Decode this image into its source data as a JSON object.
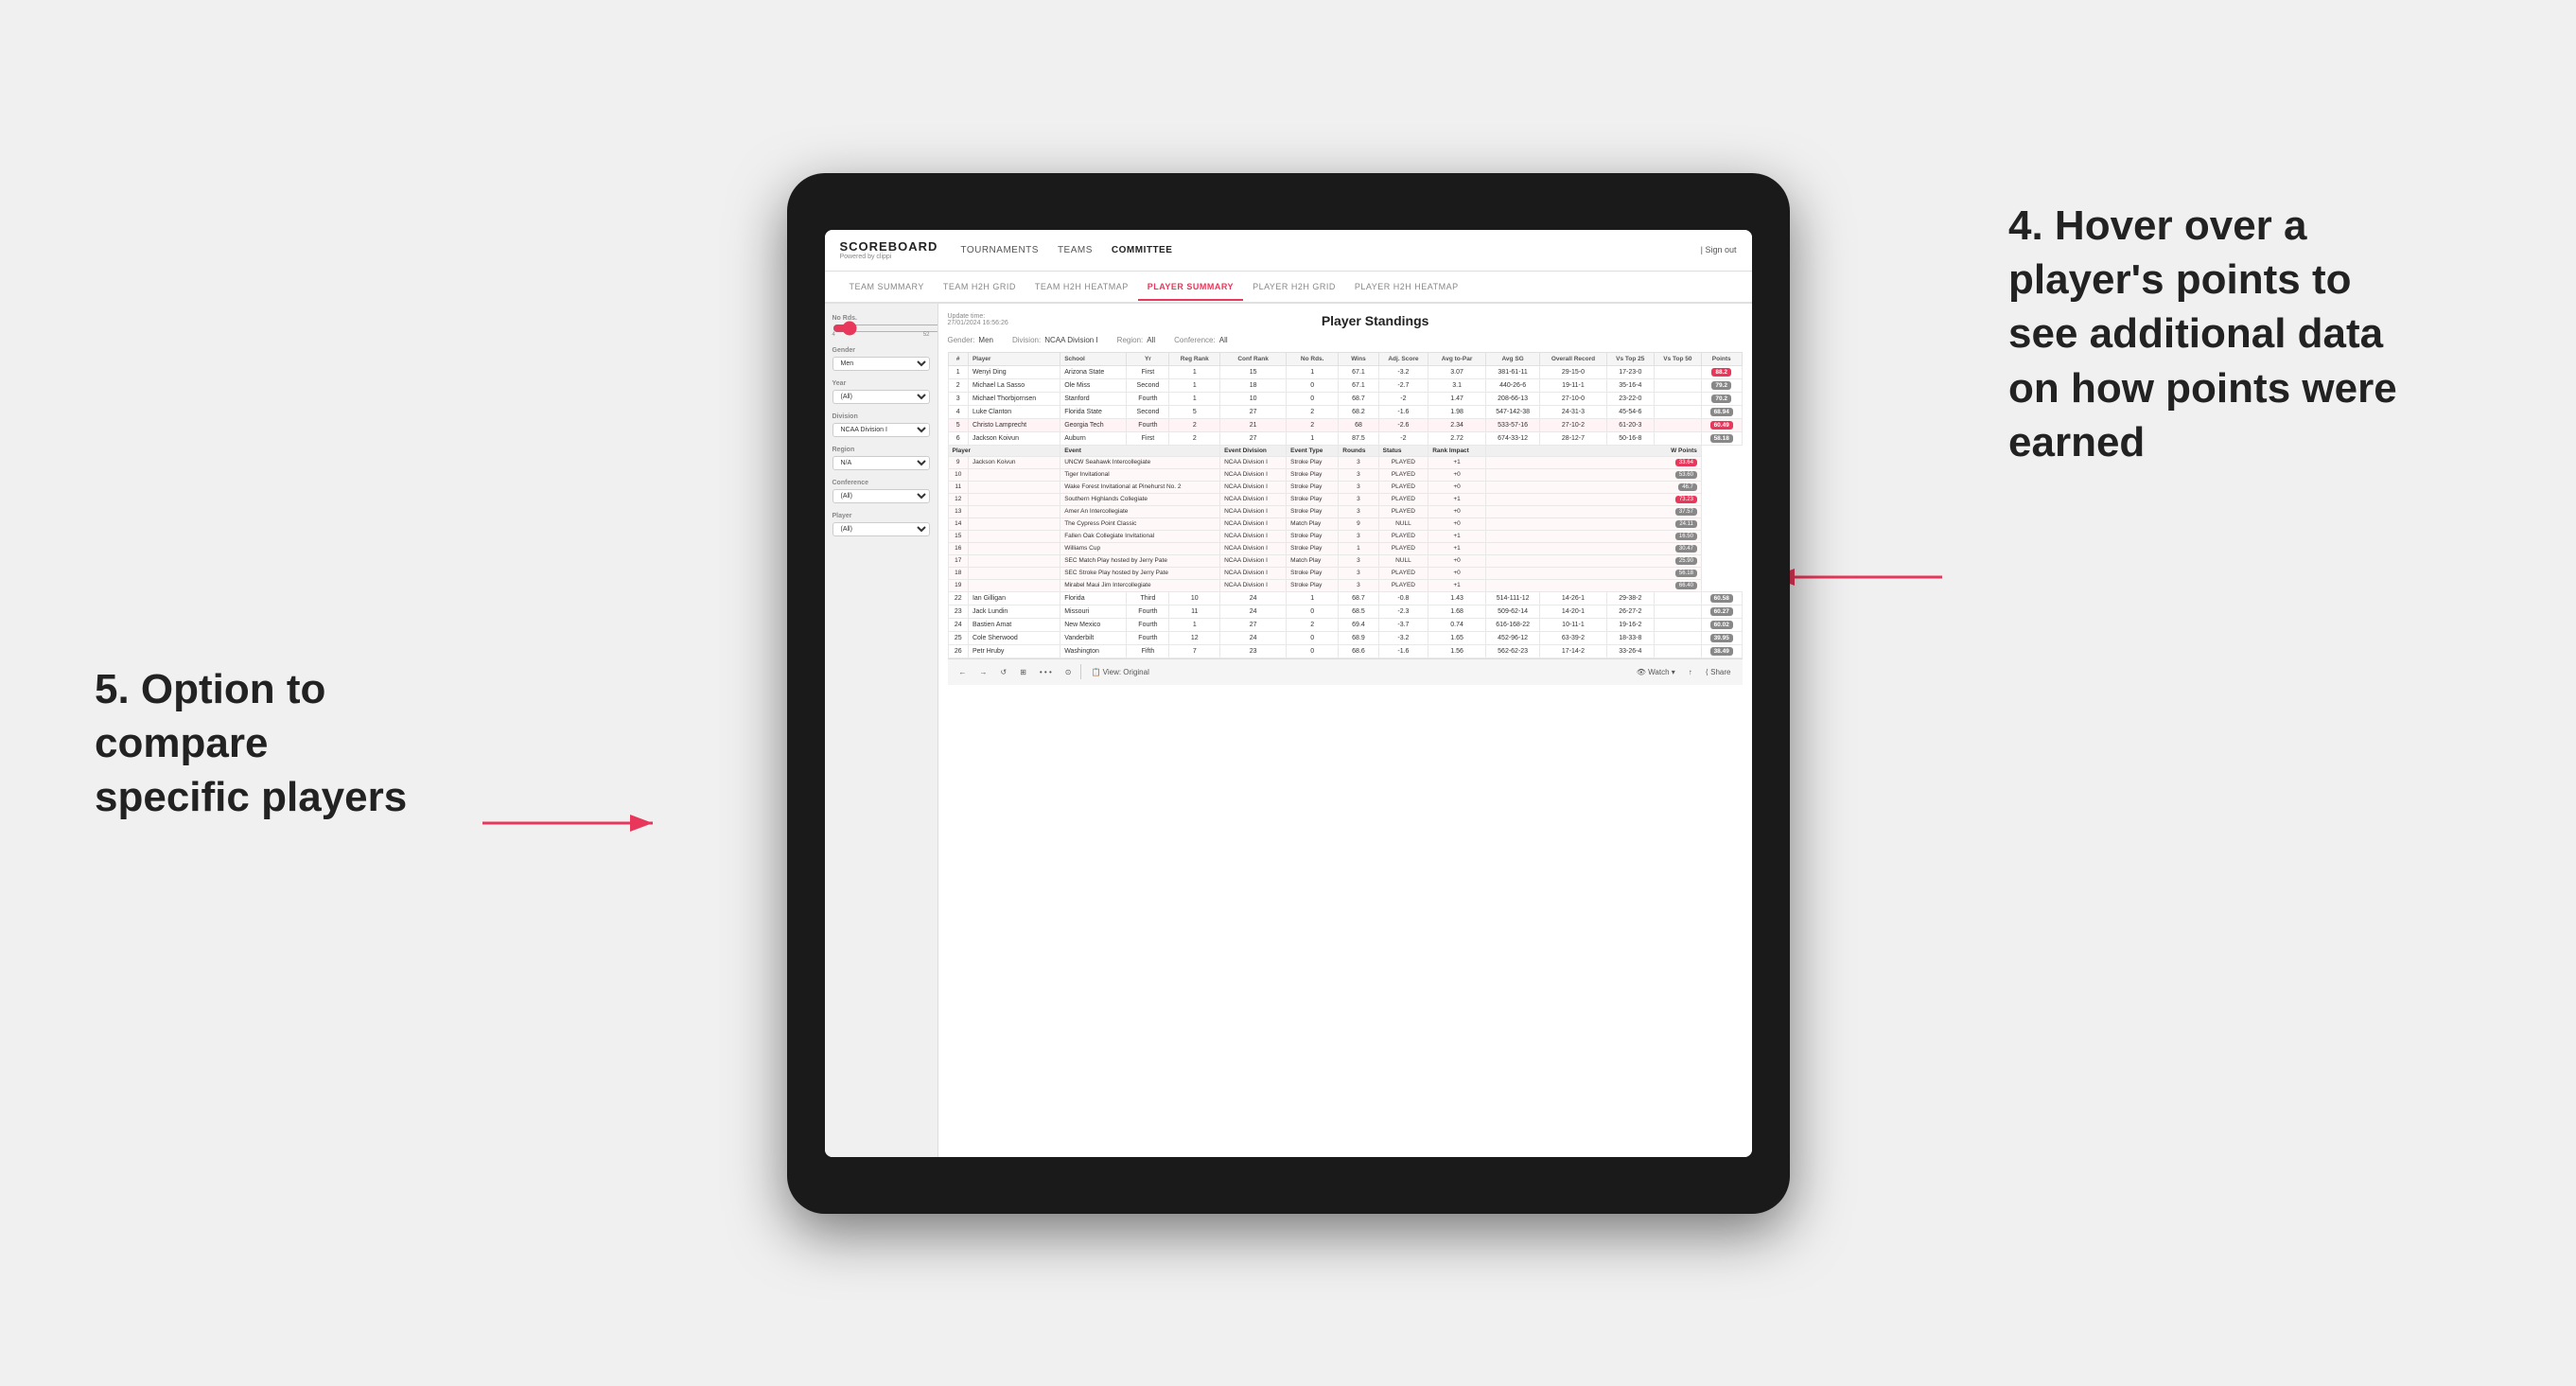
{
  "annotations": {
    "right_title": "4. Hover over a player's points to see additional data on how points were earned",
    "left_title": "5. Option to compare specific players"
  },
  "nav": {
    "logo": "SCOREBOARD",
    "logo_sub": "Powered by clippi",
    "links": [
      "TOURNAMENTS",
      "TEAMS",
      "COMMITTEE"
    ],
    "active_link": "COMMITTEE",
    "right": "| Sign out"
  },
  "sub_nav": {
    "links": [
      "TEAM SUMMARY",
      "TEAM H2H GRID",
      "TEAM H2H HEATMAP",
      "PLAYER SUMMARY",
      "PLAYER H2H GRID",
      "PLAYER H2H HEATMAP"
    ],
    "active": "PLAYER SUMMARY"
  },
  "sidebar": {
    "no_rds_label": "No Rds.",
    "no_rds_from": "4",
    "no_rds_to": "52",
    "gender_label": "Gender",
    "gender_value": "Men",
    "year_label": "Year",
    "year_value": "(All)",
    "division_label": "Division",
    "division_value": "NCAA Division I",
    "region_label": "Region",
    "region_value": "N/A",
    "conference_label": "Conference",
    "conference_value": "(All)",
    "player_label": "Player",
    "player_value": "(All)"
  },
  "panel": {
    "update_label": "Update time:",
    "update_time": "27/01/2024 16:56:26",
    "title": "Player Standings",
    "filters": {
      "gender_label": "Gender:",
      "gender_value": "Men",
      "division_label": "Division:",
      "division_value": "NCAA Division I",
      "region_label": "Region:",
      "region_value": "All",
      "conference_label": "Conference:",
      "conference_value": "All"
    },
    "table_headers": [
      "#",
      "Player",
      "School",
      "Yr",
      "Reg Rank",
      "Conf Rank",
      "No Rds.",
      "Wins",
      "Adj. Score",
      "Avg to-Par",
      "Avg SG",
      "Overall Record",
      "Vs Top 25",
      "Vs Top 50",
      "Points"
    ],
    "players": [
      {
        "rank": 1,
        "name": "Wenyi Ding",
        "school": "Arizona State",
        "yr": "First",
        "reg_rank": 1,
        "conf_rank": 15,
        "no_rds": 1,
        "wins": 67.1,
        "adj_score": -3.2,
        "avg_par": 3.07,
        "avg_sg": "381-61-11",
        "overall": "29-15-0",
        "vs25": "17-23-0",
        "vs50": "",
        "points": "88.2",
        "points_color": "red"
      },
      {
        "rank": 2,
        "name": "Michael La Sasso",
        "school": "Ole Miss",
        "yr": "Second",
        "reg_rank": 1,
        "conf_rank": 18,
        "no_rds": 0,
        "wins": 67.1,
        "adj_score": -2.7,
        "avg_par": 3.1,
        "avg_sg": "440-26-6",
        "overall": "19-11-1",
        "vs25": "35-16-4",
        "vs50": "",
        "points": "79.2",
        "points_color": "gray"
      },
      {
        "rank": 3,
        "name": "Michael Thorbjornsen",
        "school": "Stanford",
        "yr": "Fourth",
        "reg_rank": 1,
        "conf_rank": 10,
        "no_rds": 0,
        "wins": 68.7,
        "adj_score": -2.0,
        "avg_par": 1.47,
        "avg_sg": "208-66-13",
        "overall": "27-10-0",
        "vs25": "23-22-0",
        "vs50": "",
        "points": "70.2",
        "points_color": "gray"
      },
      {
        "rank": 4,
        "name": "Luke Clanton",
        "school": "Florida State",
        "yr": "Second",
        "reg_rank": 5,
        "conf_rank": 27,
        "no_rds": 2,
        "wins": 68.2,
        "adj_score": -1.6,
        "avg_par": 1.98,
        "avg_sg": "547-142-38",
        "overall": "24-31-3",
        "vs25": "45-54-6",
        "vs50": "",
        "points": "68.94",
        "points_color": "gray"
      },
      {
        "rank": 5,
        "name": "Christo Lamprecht",
        "school": "Georgia Tech",
        "yr": "Fourth",
        "reg_rank": 2,
        "conf_rank": 21,
        "no_rds": 2,
        "wins": 68.0,
        "adj_score": -2.6,
        "avg_par": 2.34,
        "avg_sg": "533-57-16",
        "overall": "27-10-2",
        "vs25": "61-20-3",
        "vs50": "",
        "points": "60.49",
        "points_color": "red",
        "highlighted": true
      },
      {
        "rank": 6,
        "name": "Jackson Koivun",
        "school": "Auburn",
        "yr": "First",
        "reg_rank": 2,
        "conf_rank": 27,
        "no_rds": 1,
        "wins": 87.5,
        "adj_score": -2.0,
        "avg_par": 2.72,
        "avg_sg": "674-33-12",
        "overall": "28-12-7",
        "vs25": "50-16-8",
        "vs50": "",
        "points": "58.18",
        "points_color": "gray"
      }
    ],
    "event_section_header": [
      "Player",
      "Event",
      "Event Division",
      "Event Type",
      "Rounds",
      "Status",
      "Rank Impact",
      "W Points"
    ],
    "event_rows": [
      {
        "player": "Jackson Koivun",
        "event": "UNCW Seahawk Intercollegiate",
        "division": "NCAA Division I",
        "type": "Stroke Play",
        "rounds": 3,
        "status": "PLAYED",
        "rank_impact": "+1",
        "w_points": "33.64",
        "color": "red"
      },
      {
        "player": "",
        "event": "Tiger Invitational",
        "division": "NCAA Division I",
        "type": "Stroke Play",
        "rounds": 3,
        "status": "PLAYED",
        "rank_impact": "+0",
        "w_points": "53.60",
        "color": "gray"
      },
      {
        "player": "",
        "event": "Wake Forest Invitational at Pinehurst No. 2",
        "division": "NCAA Division I",
        "type": "Stroke Play",
        "rounds": 3,
        "status": "PLAYED",
        "rank_impact": "+0",
        "w_points": "46.7",
        "color": "gray"
      },
      {
        "player": "",
        "event": "Southern Highlands Collegiate",
        "division": "NCAA Division I",
        "type": "Stroke Play",
        "rounds": 3,
        "status": "PLAYED",
        "rank_impact": "+1",
        "w_points": "73.23",
        "color": "red"
      },
      {
        "player": "",
        "event": "Amer An Intercollegiate",
        "division": "NCAA Division I",
        "type": "Stroke Play",
        "rounds": 3,
        "status": "PLAYED",
        "rank_impact": "+0",
        "w_points": "37.57",
        "color": "gray"
      },
      {
        "player": "",
        "event": "The Cypress Point Classic",
        "division": "NCAA Division I",
        "type": "Match Play",
        "rounds": 9,
        "status": "NULL",
        "rank_impact": "+0",
        "w_points": "24.11",
        "color": "gray"
      },
      {
        "player": "",
        "event": "Fallen Oak Collegiate Invitational",
        "division": "NCAA Division I",
        "type": "Stroke Play",
        "rounds": 3,
        "status": "PLAYED",
        "rank_impact": "+1",
        "w_points": "16.50",
        "color": "gray"
      },
      {
        "player": "",
        "event": "Williams Cup",
        "division": "NCAA Division I",
        "type": "Stroke Play",
        "rounds": 1,
        "status": "PLAYED",
        "rank_impact": "+1",
        "w_points": "30.47",
        "color": "gray"
      },
      {
        "player": "",
        "event": "SEC Match Play hosted by Jerry Pate",
        "division": "NCAA Division I",
        "type": "Match Play",
        "rounds": 3,
        "status": "NULL",
        "rank_impact": "+0",
        "w_points": "25.90",
        "color": "gray"
      },
      {
        "player": "",
        "event": "SEC Stroke Play hosted by Jerry Pate",
        "division": "NCAA Division I",
        "type": "Stroke Play",
        "rounds": 3,
        "status": "PLAYED",
        "rank_impact": "+0",
        "w_points": "56.18",
        "color": "gray"
      },
      {
        "player": "",
        "event": "Mirabel Maui Jim Intercollegiate",
        "division": "NCAA Division I",
        "type": "Stroke Play",
        "rounds": 3,
        "status": "PLAYED",
        "rank_impact": "+1",
        "w_points": "66.40",
        "color": "gray"
      }
    ],
    "more_players": [
      {
        "rank": 22,
        "name": "Ian Gilligan",
        "school": "Florida",
        "yr": "Third",
        "reg_rank": 10,
        "conf_rank": 24,
        "no_rds": 1,
        "wins": 68.7,
        "adj_score": -0.8,
        "avg_par": 1.43,
        "avg_sg": "514-111-12",
        "overall": "14-26-1",
        "vs25": "29-38-2",
        "vs50": "",
        "points": "60.58",
        "points_color": "gray"
      },
      {
        "rank": 23,
        "name": "Jack Lundin",
        "school": "Missouri",
        "yr": "Fourth",
        "reg_rank": 11,
        "conf_rank": 24,
        "no_rds": 0,
        "wins": 68.5,
        "adj_score": -2.3,
        "avg_par": 1.68,
        "avg_sg": "509-62-14",
        "overall": "14-20-1",
        "vs25": "26-27-2",
        "vs50": "",
        "points": "60.27",
        "points_color": "gray"
      },
      {
        "rank": 24,
        "name": "Bastien Amat",
        "school": "New Mexico",
        "yr": "Fourth",
        "reg_rank": 1,
        "conf_rank": 27,
        "no_rds": 2,
        "wins": 69.4,
        "adj_score": -3.7,
        "avg_par": 0.74,
        "avg_sg": "616-168-22",
        "overall": "10-11-1",
        "vs25": "19-16-2",
        "vs50": "",
        "points": "60.02",
        "points_color": "gray"
      },
      {
        "rank": 25,
        "name": "Cole Sherwood",
        "school": "Vanderbilt",
        "yr": "Fourth",
        "reg_rank": 12,
        "conf_rank": 24,
        "no_rds": 0,
        "wins": 68.9,
        "adj_score": -3.2,
        "avg_par": 1.65,
        "avg_sg": "452-96-12",
        "overall": "63-39-2",
        "vs25": "18-33-8",
        "vs50": "",
        "points": "39.95",
        "points_color": "gray"
      },
      {
        "rank": 26,
        "name": "Petr Hruby",
        "school": "Washington",
        "yr": "Fifth",
        "reg_rank": 7,
        "conf_rank": 23,
        "no_rds": 0,
        "wins": 68.6,
        "adj_score": -1.6,
        "avg_par": 1.56,
        "avg_sg": "562-62-23",
        "overall": "17-14-2",
        "vs25": "33-26-4",
        "vs50": "",
        "points": "38.49",
        "points_color": "gray"
      }
    ]
  },
  "toolbar": {
    "buttons": [
      "←",
      "→",
      "↺",
      "⊞",
      "∘ ∘ ∘",
      "⊙"
    ],
    "view_label": "View: Original",
    "watch_label": "Watch",
    "export_label": "↑",
    "share_label": "Share"
  }
}
